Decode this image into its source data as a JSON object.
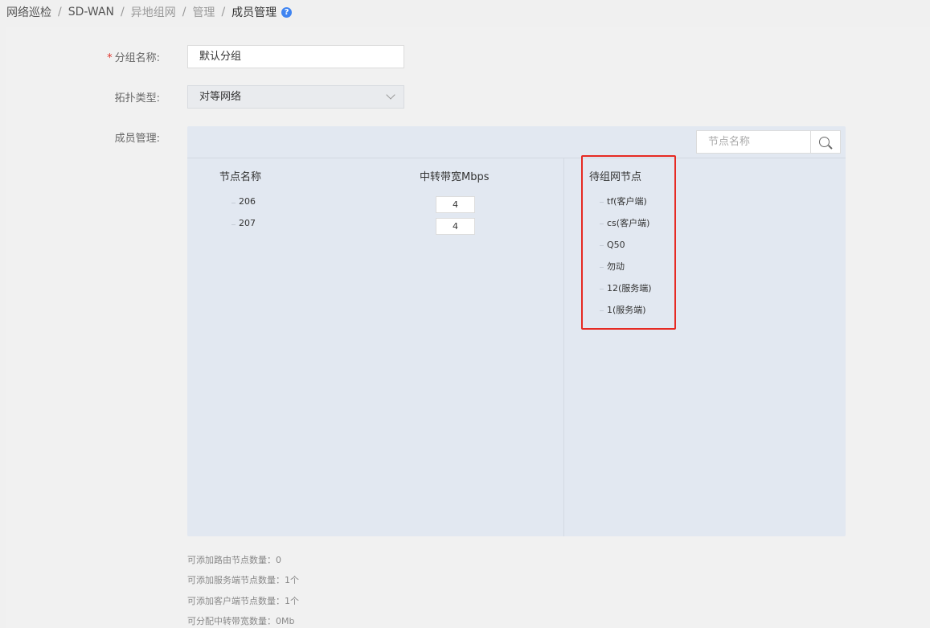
{
  "breadcrumb": {
    "items": [
      "网络巡检",
      "SD-WAN",
      "异地组网",
      "管理",
      "成员管理"
    ],
    "separator": "/"
  },
  "form": {
    "group_name_label": "分组名称:",
    "group_name_required_mark": "*",
    "group_name_value": "默认分组",
    "topology_label": "拓扑类型:",
    "topology_value": "对等网络",
    "member_label": "成员管理:"
  },
  "member_panel": {
    "search_placeholder": "节点名称",
    "col_node_name": "节点名称",
    "col_bandwidth": "中转带宽Mbps",
    "col_pending": "待组网节点",
    "members": [
      {
        "name": "206",
        "bandwidth": "4"
      },
      {
        "name": "207",
        "bandwidth": "4"
      }
    ],
    "pending_nodes": [
      "tf(客户端)",
      "cs(客户端)",
      "Q50",
      "勿动",
      "12(服务端)",
      "1(服务端)"
    ]
  },
  "stats": [
    "可添加路由节点数量：0",
    "可添加服务端节点数量：1个",
    "可添加客户端节点数量：1个",
    "可分配中转带宽数量：0Mb"
  ],
  "colors": {
    "highlight": "#e62a23",
    "help_icon": "#3f84f1",
    "panel_bg": "#e2e8f1"
  }
}
